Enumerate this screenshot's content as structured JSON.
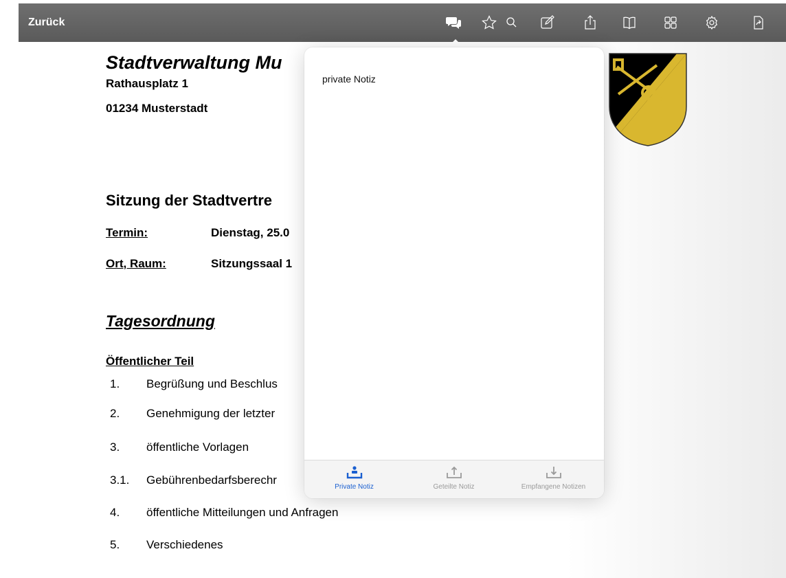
{
  "toolbar": {
    "back_label": "Zurück",
    "icons": [
      "comments-icon",
      "star-icon",
      "search-icon",
      "edit-icon",
      "share-icon",
      "book-icon",
      "grid-icon",
      "settings-icon",
      "export-icon"
    ]
  },
  "document": {
    "org_name": "Stadtverwaltung Mu",
    "address_line1": "Rathausplatz 1",
    "address_line2": "01234 Musterstadt",
    "meeting_title": "Sitzung der Stadtvertre",
    "termin_label": "Termin:",
    "termin_value": "Dienstag, 25.0",
    "ort_label": "Ort, Raum:",
    "ort_value": "Sitzungssaal 1",
    "agenda_heading": "Tagesordnung",
    "public_heading": "Öffentlicher Teil",
    "items": [
      {
        "num": "1.",
        "text": "Begrüßung und Beschlus"
      },
      {
        "num": "2.",
        "text": "Genehmigung der letzter"
      },
      {
        "num": "3.",
        "text": "öffentliche Vorlagen"
      },
      {
        "num": "3.1.",
        "text": "Gebührenbedarfsberechr"
      },
      {
        "num": "4.",
        "text": "öffentliche Mitteilungen und Anfragen"
      },
      {
        "num": "5.",
        "text": "Verschiedenes"
      }
    ]
  },
  "popover": {
    "note_text": "private Notiz",
    "tabs": [
      {
        "label": "Private Notiz",
        "active": true
      },
      {
        "label": "Geteilte Notiz",
        "active": false
      },
      {
        "label": "Empfangene Notizen",
        "active": false
      }
    ]
  },
  "colors": {
    "toolbar_bg": "#636363",
    "accent": "#1a5fd0",
    "inactive_tab": "#9a9a9a",
    "crest_gold": "#d9b72f",
    "crest_black": "#000000"
  }
}
